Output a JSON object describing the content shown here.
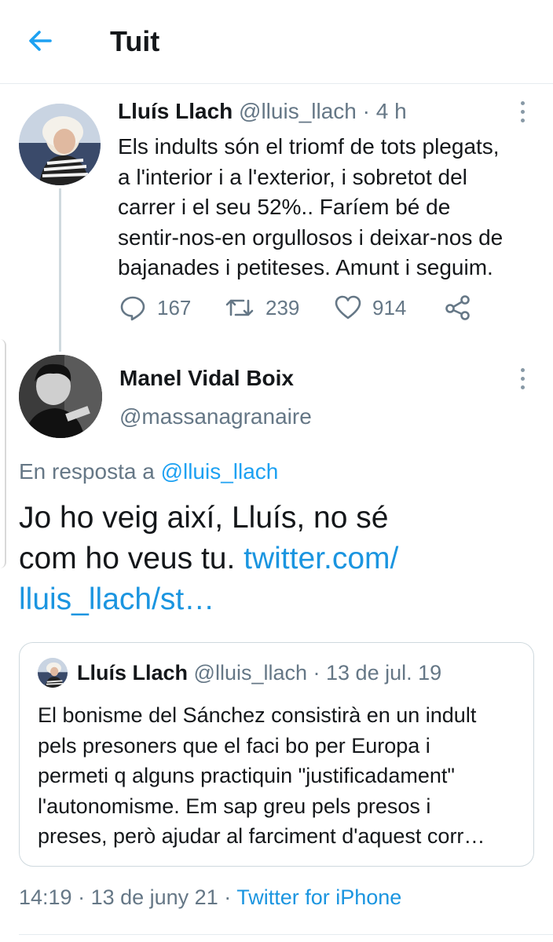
{
  "header": {
    "title": "Tuit",
    "back_icon": "arrow-left-icon",
    "accent": "#1da1f2"
  },
  "tweet": {
    "author_name": "Lluís Llach",
    "author_handle": "@lluis_llach",
    "separator": " · ",
    "time": "4 h",
    "lines": [
      "Els indults són el triomf de tots plegats,",
      "a l'interior i a l'exterior, i sobretot del",
      "carrer i el seu 52%.. Faríem bé de",
      "sentir-nos-en orgullosos i deixar-nos de",
      "bajanades i petiteses. Amunt i seguim."
    ],
    "replies": "167",
    "retweets": "239",
    "likes": "914"
  },
  "reply": {
    "author_name": "Manel Vidal Boix",
    "author_handle": "@massanagranaire",
    "in_reply_to_label": "En resposta a ",
    "in_reply_to_handle": "@lluis_llach",
    "text_line1": "Jo ho veig així, Lluís, no sé",
    "text_line2": "com ho veus tu. ",
    "link_part1": "twitter.com/",
    "link_part2": "lluis_llach/st…"
  },
  "quoted": {
    "author_name": "Lluís Llach",
    "author_handle": "@lluis_llach",
    "separator": " · ",
    "date": "13 de jul. 19",
    "lines": [
      "El bonisme del Sánchez consistirà en un indult",
      "pels presoners que el faci bo per Europa i",
      "permeti q alguns practiquin \"justificadament\"",
      "l'autonomisme. Em sap greu pels presos i",
      "preses, però ajudar al farciment d'aquest corr…"
    ]
  },
  "meta": {
    "time": "14:19",
    "separator": " · ",
    "date": "13 de juny 21",
    "source": "Twitter for iPhone"
  }
}
